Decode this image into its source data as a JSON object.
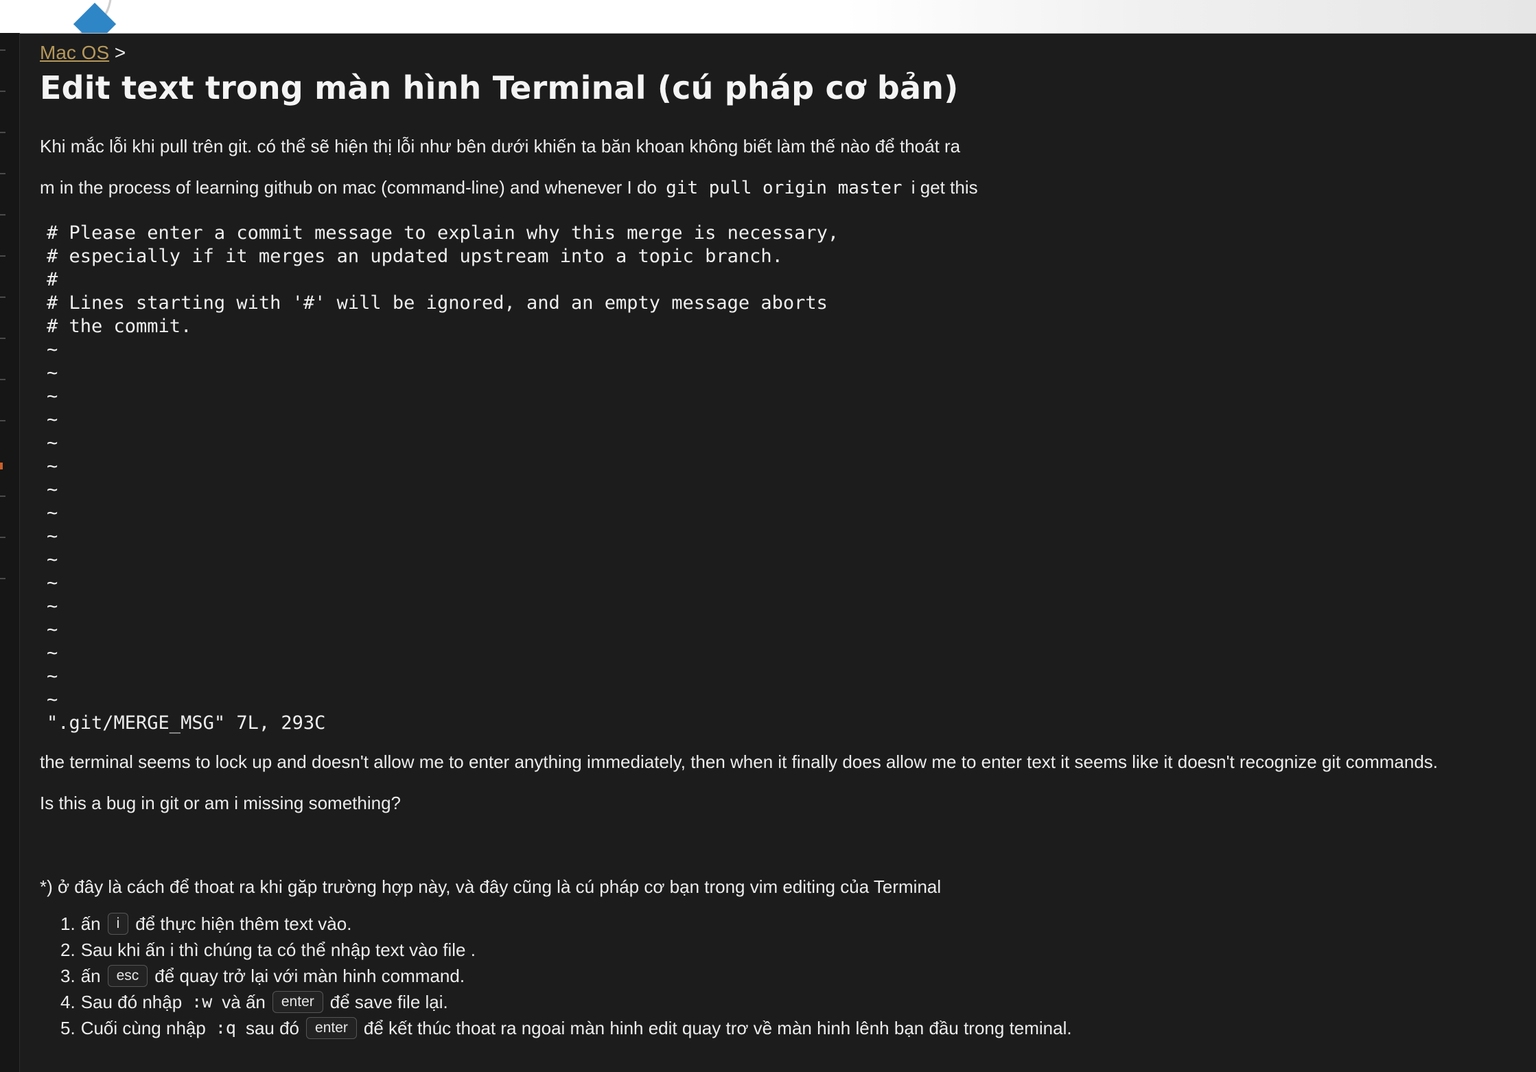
{
  "breadcrumb": {
    "link": "Mac OS",
    "separator": ">"
  },
  "title": "Edit text trong màn hình Terminal (cú pháp cơ bản)",
  "intro": "Khi mắc lỗi khi pull trên git. có thể sẽ hiện thị lỗi như bên dưới khiến ta băn khoan không biết làm thế nào để thoát ra",
  "question": {
    "before": "m in the process of learning github on mac (command-line) and whenever I do",
    "code": "git pull origin master",
    "after": "i get this"
  },
  "terminal_lines": [
    "# Please enter a commit message to explain why this merge is necessary,",
    "# especially if it merges an updated upstream into a topic branch.",
    "#",
    "# Lines starting with '#' will be ignored, and an empty message aborts",
    "# the commit.",
    "~",
    "~",
    "~",
    "~",
    "~",
    "~",
    "~",
    "~",
    "~",
    "~",
    "~",
    "~",
    "~",
    "~",
    "~",
    "~",
    "\".git/MERGE_MSG\" 7L, 293C"
  ],
  "para_lock": "the terminal seems to lock up and doesn't allow me to enter anything immediately, then when it finally does allow me to enter text it seems like it doesn't recognize git commands.",
  "para_bug": "Is this a bug in git or am i missing something?",
  "para_solution": "*) ở đây là cách để thoat ra khi găp trường hợp này, và đây cũng là cú pháp cơ bạn trong vim editing của Terminal",
  "steps": [
    {
      "num": "1.",
      "a": "ấn",
      "key": "i",
      "b": "để thực hiện thêm text vào."
    },
    {
      "num": "2.",
      "a": "Sau khi ấn i thì chúng ta có thể nhập text vào file ."
    },
    {
      "num": "3.",
      "a": "ấn",
      "key": "esc",
      "b": "để quay trở lại với màn hinh command."
    },
    {
      "num": "4.",
      "a": "Sau đó nhập",
      "cmd": ":w",
      "c": "và ấn",
      "key": "enter",
      "b": "để save file lại."
    },
    {
      "num": "5.",
      "a": "Cuối cùng nhập",
      "cmd": ":q",
      "c": "sau đó",
      "key": "enter",
      "b": "để kết thúc thoat ra ngoai màn hinh edit quay trơ về màn hinh lênh bạn đầu trong teminal."
    }
  ]
}
